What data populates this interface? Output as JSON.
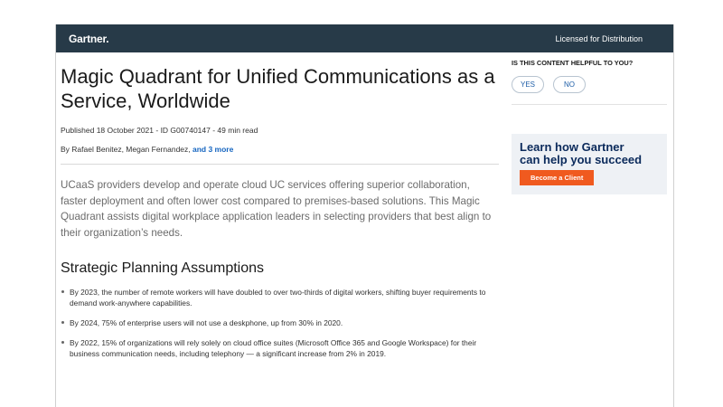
{
  "header": {
    "logo": "Gartner.",
    "licensed": "Licensed for Distribution"
  },
  "article": {
    "title": "Magic Quadrant for Unified Communications as a Service, Worldwide",
    "meta": "Published 18 October 2021 - ID G00740147 - 49 min read",
    "authors_prefix": "By Rafael Benitez, Megan Fernandez, ",
    "authors_more": "and 3 more",
    "summary": "UCaaS providers develop and operate cloud UC services offering superior collaboration, faster deployment and often lower cost compared to premises-based solutions. This Magic Quadrant assists digital workplace application leaders in selecting providers that best align to their organization’s needs.",
    "section_title": "Strategic Planning Assumptions",
    "bullets": [
      "By 2023, the number of remote workers will have doubled to over two-thirds of digital workers, shifting buyer requirements to demand work-anywhere capabilities.",
      "By 2024, 75% of enterprise users will not use a deskphone, up from 30% in 2020.",
      "By 2022, 15% of organizations will rely solely on cloud office suites (Microsoft Office 365 and Google Workspace) for their business communication needs, including telephony — a significant increase from 2% in 2019."
    ]
  },
  "sidebar": {
    "helpful_question": "IS THIS CONTENT HELPFUL TO YOU?",
    "yes_label": "YES",
    "no_label": "NO",
    "promo_title_line1": "Learn how Gartner",
    "promo_title_line2": "can help you succeed",
    "promo_button": "Become a Client"
  },
  "colors": {
    "header_bg": "#273a48",
    "link": "#1565c0",
    "promo_bg": "#eef1f5",
    "promo_title": "#0b2a5b",
    "cta_bg": "#f05a1f"
  }
}
